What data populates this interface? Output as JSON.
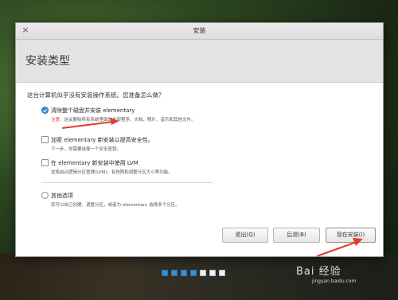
{
  "window": {
    "title": "安装",
    "close_glyph": "×"
  },
  "page": {
    "title": "安装类型"
  },
  "question": "这台计算机似乎没有安装操作系统。您准备怎么做？",
  "options": [
    {
      "label": "清除整个磁盘并安装 elementary",
      "desc_warning_key": "注意：",
      "desc": "这会删除所有系统里面的全部程序、文档、照片、音乐和其他文件。",
      "selected": true
    },
    {
      "label": "加密 elementary 新安装以提高安全性。",
      "desc": "下一步，你需要选择一个安全密钥。",
      "checked": false
    },
    {
      "label": "在 elementary 新安装中使用 LVM",
      "desc": "这将启动逻辑分区管理(LVM)，有快照和调整分区大小等功能。",
      "checked": false
    },
    {
      "label": "其他选项",
      "desc": "您可以自己创建、调整分区，或者为 elementary 选择多个分区。",
      "selected": false
    }
  ],
  "buttons": {
    "quit": "退出(Q)",
    "back": "后退(B)",
    "install_now": "现在安装(I)"
  },
  "progress": {
    "total_steps": 7,
    "completed_steps": 4
  },
  "watermark": {
    "brand": "Bai 经验",
    "url": "jingyan.baidu.com"
  },
  "colors": {
    "accent": "#3b8ed0",
    "warning": "#d9352b",
    "annotation_arrow": "#e53a2b"
  }
}
